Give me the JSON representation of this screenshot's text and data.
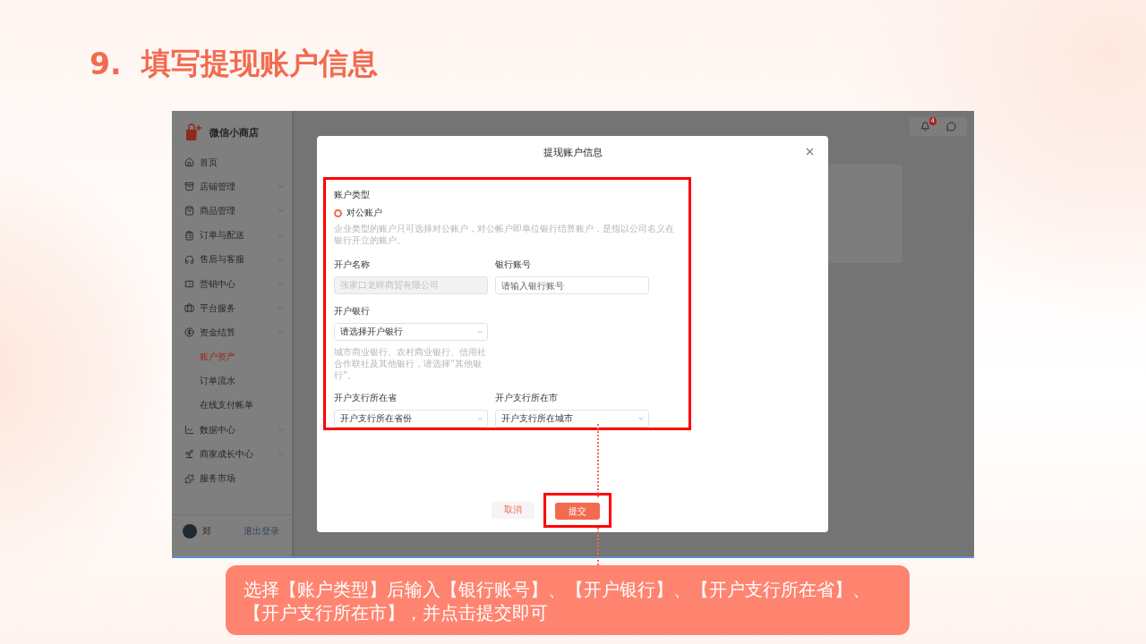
{
  "slide": {
    "step_number": "9.",
    "title": "填写提现账户信息"
  },
  "app": {
    "sidebar": {
      "brand": "微信小商店",
      "items": [
        {
          "label": "首页",
          "selected": false
        },
        {
          "label": "店铺管理",
          "selected": false,
          "expanded": false
        },
        {
          "label": "商品管理",
          "selected": false,
          "expanded": false
        },
        {
          "label": "订单与配送",
          "selected": false,
          "expanded": false
        },
        {
          "label": "售后与客服",
          "selected": false,
          "expanded": false
        },
        {
          "label": "营销中心",
          "selected": false,
          "expanded": false
        },
        {
          "label": "平台服务",
          "selected": false,
          "expanded": false
        },
        {
          "label": "资金结算",
          "selected": false,
          "expanded": true,
          "children": [
            {
              "label": "账户资产",
              "selected": true
            },
            {
              "label": "订单流水",
              "selected": false
            },
            {
              "label": "在线支付帐单",
              "selected": false
            }
          ]
        },
        {
          "label": "数据中心",
          "selected": false,
          "expanded": false
        },
        {
          "label": "商家成长中心",
          "selected": false,
          "expanded": false
        },
        {
          "label": "服务市场",
          "selected": false
        }
      ],
      "user": {
        "name": "郑",
        "logout": "退出登录"
      }
    },
    "header": {
      "notification_count": "4"
    }
  },
  "modal": {
    "title": "提现账户信息",
    "account_type": {
      "label": "账户类型",
      "options": [
        {
          "label": "对公账户",
          "selected": true
        }
      ],
      "hint": "企业类型的账户只可选择对公账户，对公帐户即单位银行结算账户，是指以公司名义在银行开立的账户。"
    },
    "fields": [
      {
        "kind": "input",
        "label": "开户名称",
        "value": "张家口龙晖商贸有限公司",
        "disabled": true
      },
      {
        "kind": "input",
        "label": "银行账号",
        "placeholder": "请输入银行账号",
        "disabled": false
      },
      {
        "kind": "select",
        "label": "开户银行",
        "value": "请选择开户银行",
        "hint": "城市商业银行、农村商业银行、信用社合作联社及其他银行，请选择“其他银行”。"
      },
      {
        "kind": "select",
        "label": "开户支行所在省",
        "value": "开户支行所在省份"
      },
      {
        "kind": "select",
        "label": "开户支行所在市",
        "value": "开户支行所在城市"
      }
    ],
    "buttons": [
      {
        "label": "取消",
        "kind": "secondary"
      },
      {
        "label": "提交",
        "kind": "primary"
      }
    ]
  },
  "callout": {
    "text": "选择【账户类型】后输入【银行账号】、【开户银行】、【开户支行所在省】、【开户支行所在市】，并点击提交即可"
  }
}
